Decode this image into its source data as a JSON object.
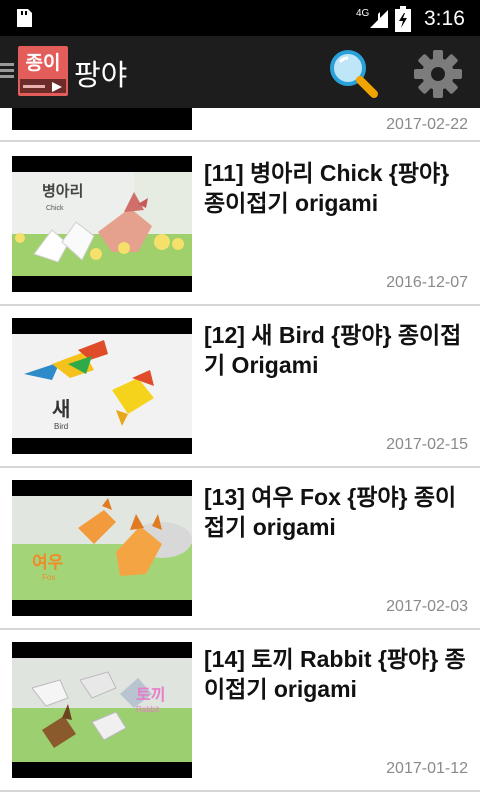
{
  "status": {
    "time": "3:16",
    "network": "4G",
    "icons": [
      "sd-card-icon",
      "signal-icon",
      "battery-icon"
    ]
  },
  "app": {
    "logo_text": "종이",
    "title": "팡야",
    "icons": [
      "menu-icon",
      "search-icon",
      "settings-icon"
    ]
  },
  "list": {
    "partial_item": {
      "date": "2017-02-22"
    },
    "items": [
      {
        "title": "[11] 병아리 Chick {팡야} 종이접기 origami",
        "date": "2016-12-07",
        "thumb_label": "병아리",
        "thumb_sub": "Chick"
      },
      {
        "title": "[12] 새 Bird {팡야} 종이접기 Origami",
        "date": "2017-02-15",
        "thumb_label": "새",
        "thumb_sub": "Bird"
      },
      {
        "title": "[13] 여우 Fox {팡야} 종이접기 origami",
        "date": "2017-02-03",
        "thumb_label": "여우",
        "thumb_sub": "Fox"
      },
      {
        "title": "[14] 토끼 Rabbit {팡야} 종이접기 origami",
        "date": "2017-01-12",
        "thumb_label": "토끼",
        "thumb_sub": "Rabbit"
      }
    ]
  },
  "colors": {
    "app_bar": "#1d1d1d",
    "logo": "#e35d5b",
    "divider": "#d6d6d6",
    "date_text": "#8a8a8a"
  }
}
